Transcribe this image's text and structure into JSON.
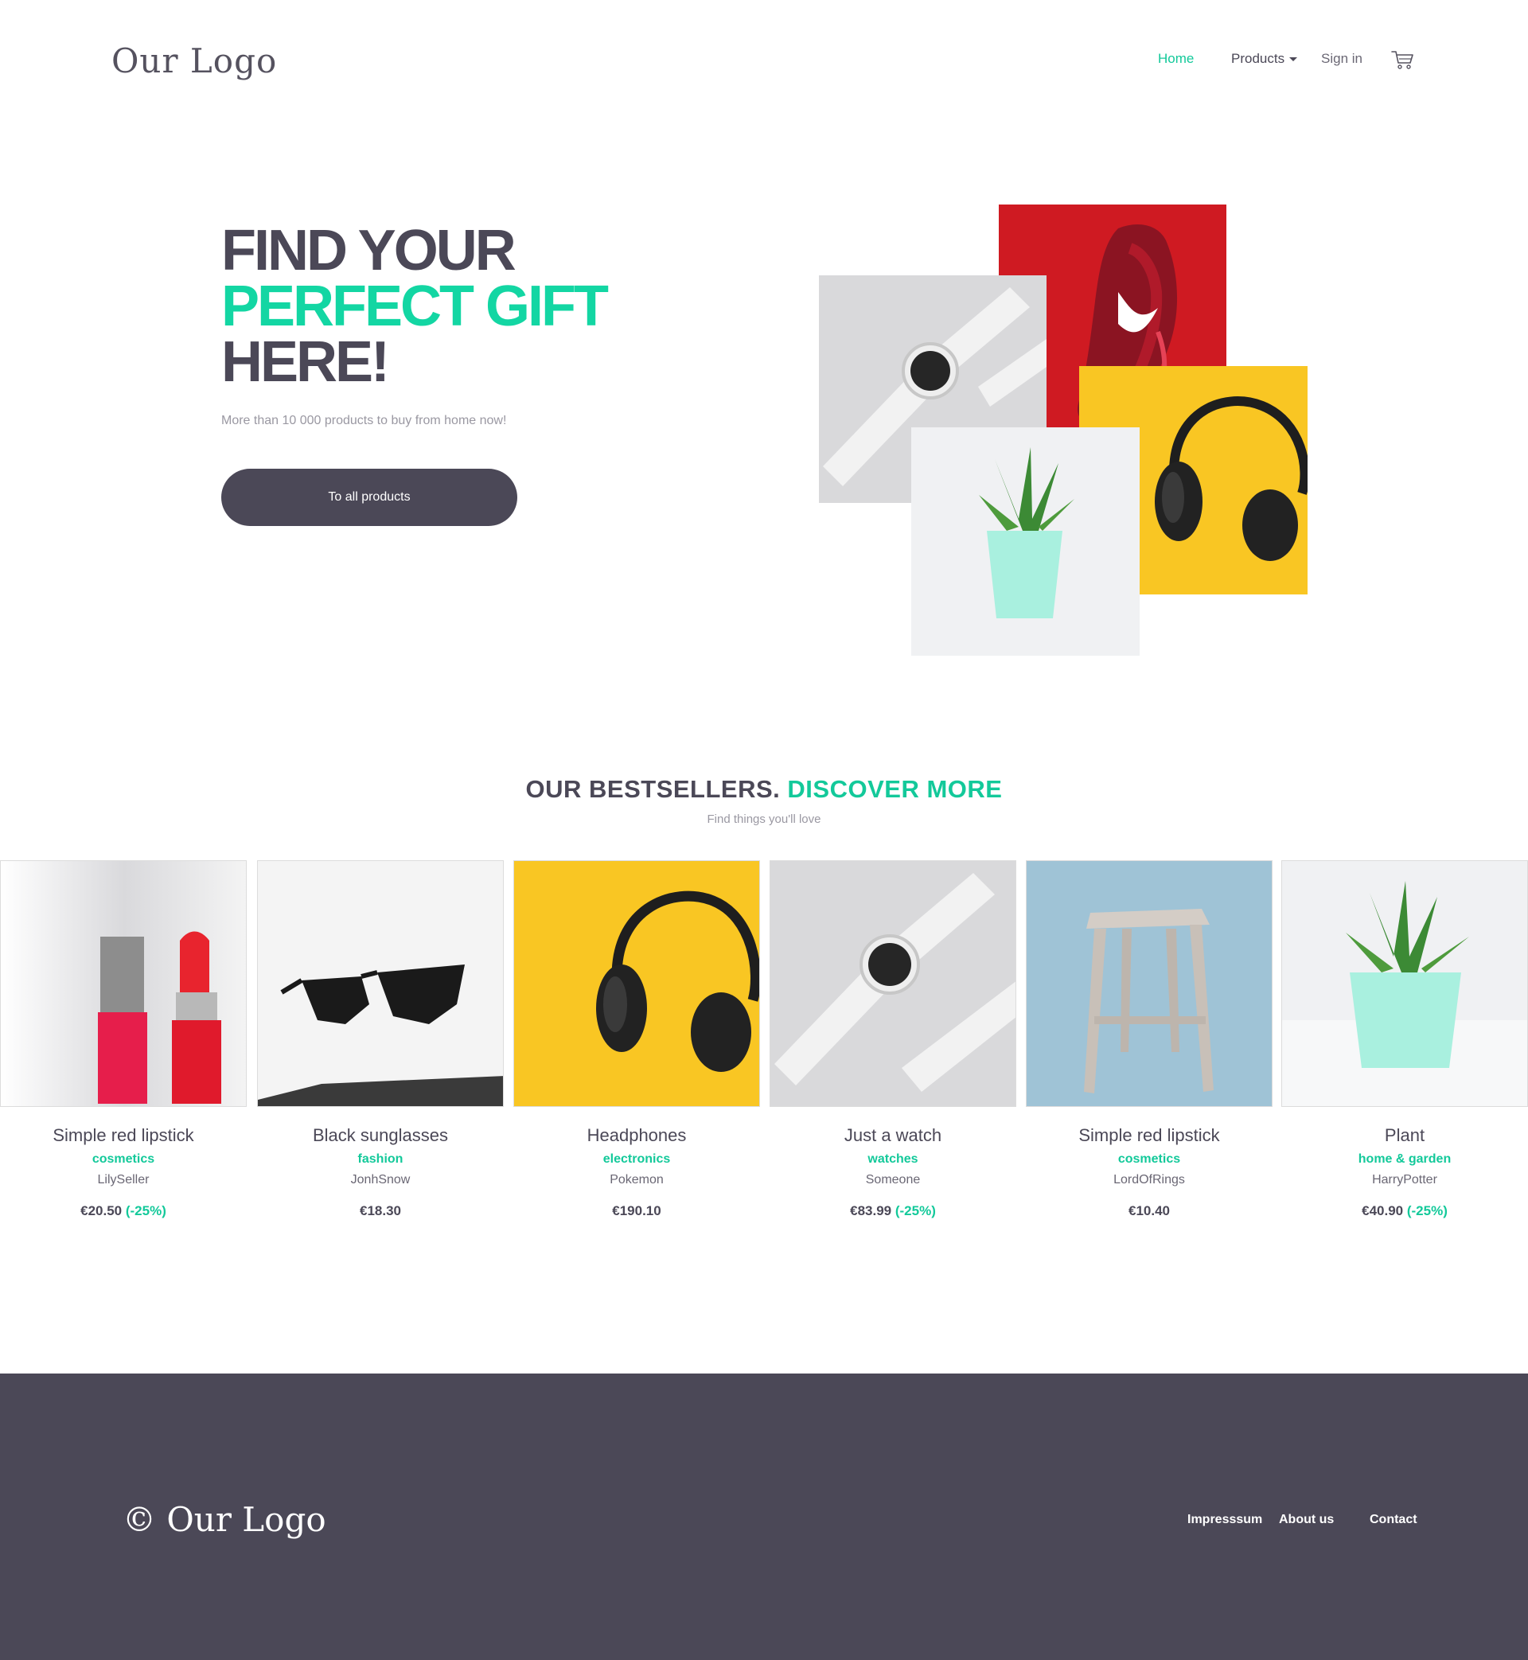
{
  "header": {
    "logo": "Our Logo",
    "nav": {
      "home": "Home",
      "products": "Products",
      "signin": "Sign in"
    }
  },
  "hero": {
    "title_line1": "FIND YOUR",
    "title_line2": "PERFECT GIFT",
    "title_line3": "HERE!",
    "subtitle": "More than 10 000 products to buy from home now!",
    "button": "To all products"
  },
  "bestsellers": {
    "title": "OUR BESTSELLERS.",
    "title_accent": "DISCOVER MORE",
    "subtitle": "Find things you'll love",
    "products": [
      {
        "name": "Simple red lipstick",
        "category": "cosmetics",
        "seller": "LilySeller",
        "price": "€20.50",
        "discount": "(-25%)"
      },
      {
        "name": "Black sunglasses",
        "category": "fashion",
        "seller": "JonhSnow",
        "price": "€18.30",
        "discount": ""
      },
      {
        "name": "Headphones",
        "category": "electronics",
        "seller": "Pokemon",
        "price": "€190.10",
        "discount": ""
      },
      {
        "name": "Just a watch",
        "category": "watches",
        "seller": "Someone",
        "price": "€83.99",
        "discount": "(-25%)"
      },
      {
        "name": "Simple red lipstick",
        "category": "cosmetics",
        "seller": "LordOfRings",
        "price": "€10.40",
        "discount": ""
      },
      {
        "name": "Plant",
        "category": "home & garden",
        "seller": "HarryPotter",
        "price": "€40.90",
        "discount": "(-25%)"
      }
    ]
  },
  "footer": {
    "logo": "© Our Logo",
    "links": {
      "impressum": "Impresssum",
      "about": "About us",
      "contact": "Contact"
    }
  },
  "colors": {
    "accent": "#13c99a",
    "dark": "#4b4857",
    "muted": "#9a98a2"
  }
}
